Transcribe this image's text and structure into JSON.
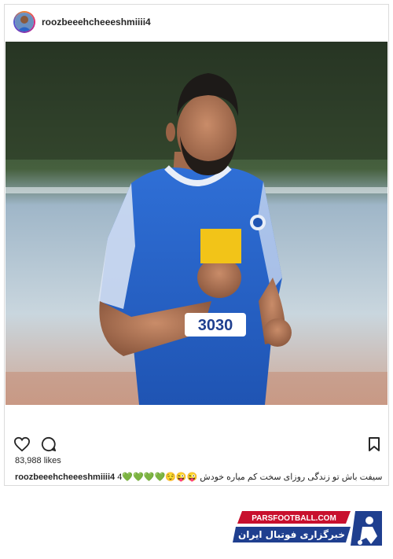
{
  "post": {
    "username": "roozbeeehcheeeshmiiii4",
    "likes": "83,988 likes",
    "caption_username": "roozbeeehcheeeshmiiii4",
    "caption_text": "4💚💚💚💚😌😜😜 سیفت باش تو زندگی روزای سخت کم میاره خودش",
    "jersey_number": "3030"
  },
  "icons": {
    "like": "heart-icon",
    "comment": "comment-icon",
    "save": "bookmark-icon"
  },
  "watermark": {
    "site": "PARSFOOTBALL.COM",
    "tagline": "خبرگزاری فوتبال ایران",
    "colors": {
      "blue": "#1f3f8f",
      "red": "#c8102e",
      "dark": "#1a1a2e"
    }
  },
  "colors": {
    "jersey_blue": "#2a64c6",
    "text": "#262626",
    "border": "#dbdbdb"
  }
}
